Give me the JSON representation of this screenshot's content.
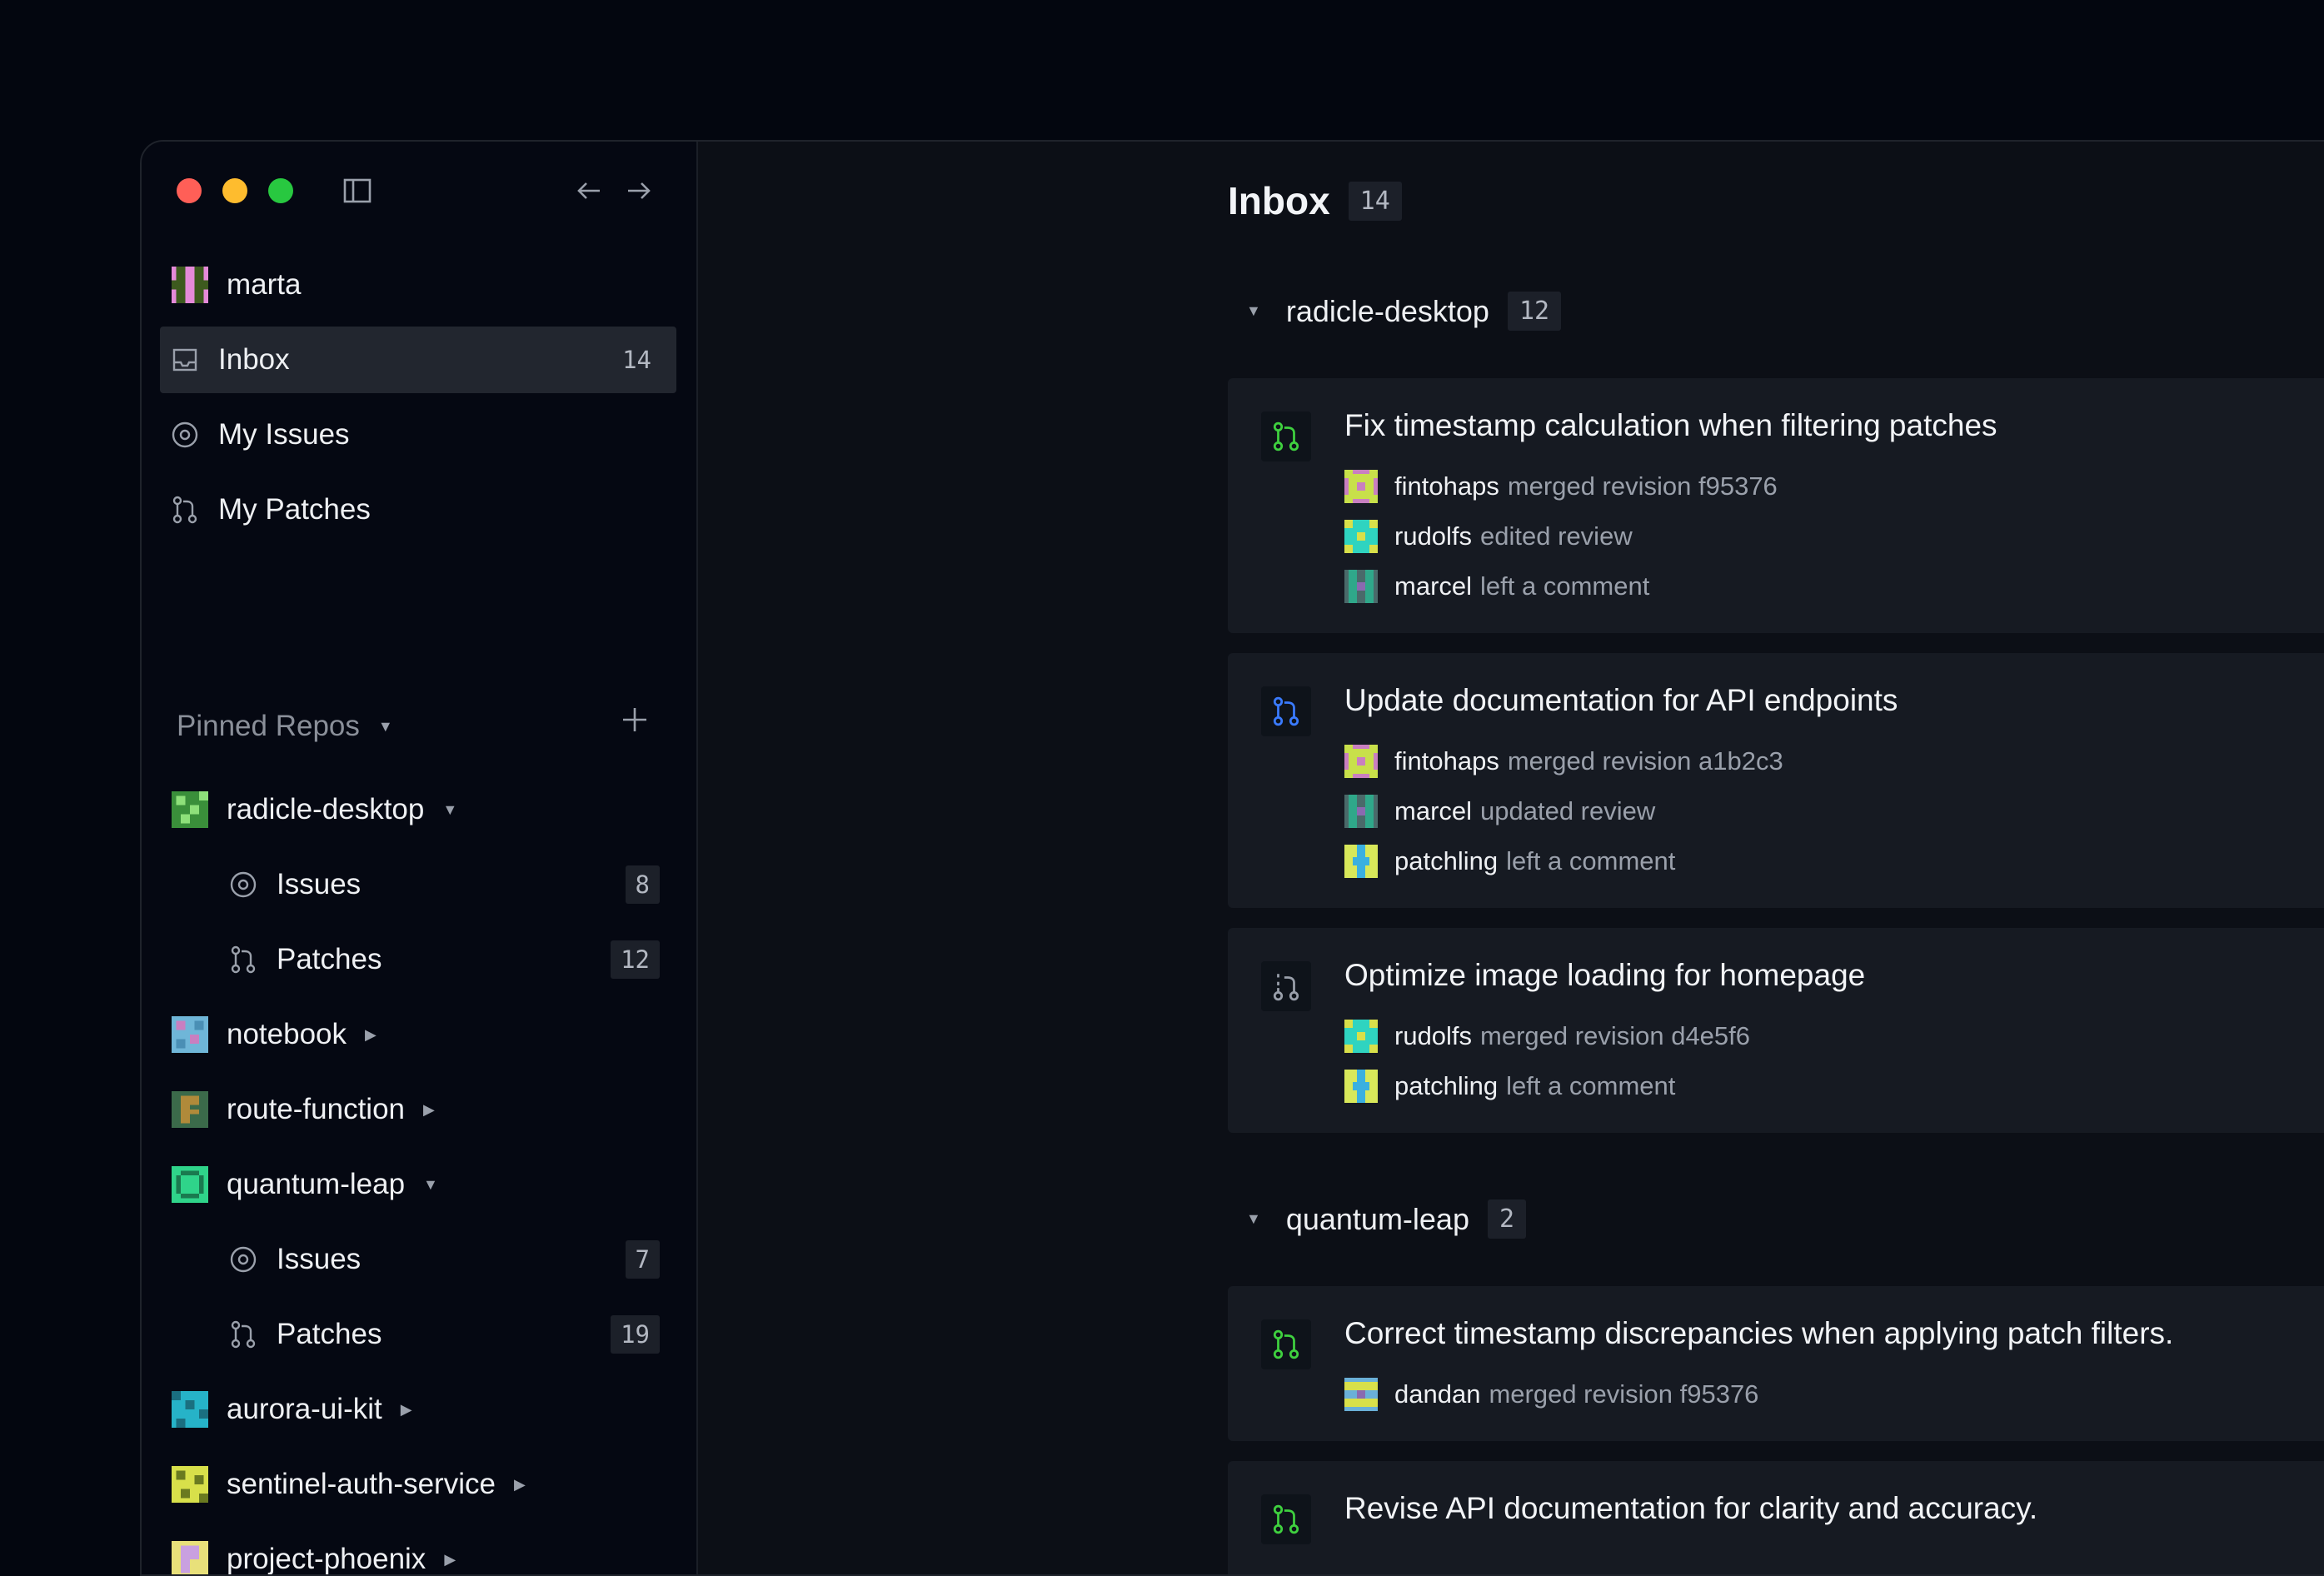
{
  "sidebar": {
    "user": {
      "name": "marta",
      "avatar": "marta-avatar"
    },
    "nav": [
      {
        "label": "Inbox",
        "count": "14",
        "icon": "inbox-icon",
        "active": true
      },
      {
        "label": "My Issues",
        "icon": "issue-icon"
      },
      {
        "label": "My Patches",
        "icon": "patch-icon"
      }
    ],
    "pinned_label": "Pinned Repos",
    "repos": [
      {
        "name": "radicle-desktop",
        "expanded": true,
        "children": [
          {
            "label": "Issues",
            "count": "8"
          },
          {
            "label": "Patches",
            "count": "12"
          }
        ]
      },
      {
        "name": "notebook"
      },
      {
        "name": "route-function"
      },
      {
        "name": "quantum-leap",
        "expanded": true,
        "children": [
          {
            "label": "Issues",
            "count": "7"
          },
          {
            "label": "Patches",
            "count": "19"
          }
        ]
      },
      {
        "name": "aurora-ui-kit"
      },
      {
        "name": "sentinel-auth-service"
      },
      {
        "name": "project-phoenix"
      }
    ]
  },
  "main": {
    "title": "Inbox",
    "count": "14",
    "groups": [
      {
        "repo": "radicle-desktop",
        "count": "12",
        "items": [
          {
            "title": "Fix timestamp calculation when filtering patches",
            "icon": "patch-merged-icon",
            "activity": [
              {
                "user": "fintohaps",
                "text": "merged revision f95376"
              },
              {
                "user": "rudolfs",
                "text": "edited review"
              },
              {
                "user": "marcel",
                "text": "left a comment"
              }
            ]
          },
          {
            "title": "Update documentation for API endpoints",
            "icon": "patch-open-icon",
            "activity": [
              {
                "user": "fintohaps",
                "text": "merged revision a1b2c3"
              },
              {
                "user": "marcel",
                "text": "updated review"
              },
              {
                "user": "patchling",
                "text": "left a comment"
              }
            ]
          },
          {
            "title": "Optimize image loading for homepage",
            "icon": "patch-draft-icon",
            "activity": [
              {
                "user": "rudolfs",
                "text": "merged revision d4e5f6"
              },
              {
                "user": "patchling",
                "text": "left a comment"
              }
            ]
          }
        ]
      },
      {
        "repo": "quantum-leap",
        "count": "2",
        "items": [
          {
            "title": "Correct timestamp discrepancies when applying patch filters.",
            "icon": "patch-merged-icon",
            "activity": [
              {
                "user": "dandan",
                "text": "merged revision f95376"
              }
            ]
          },
          {
            "title": "Revise API documentation for clarity and accuracy.",
            "icon": "patch-merged-icon",
            "activity": []
          }
        ]
      }
    ]
  },
  "colors": {
    "merged": "#3fd13f",
    "open": "#3a7bff",
    "draft": "#9aa0ab",
    "background": "#03060f"
  }
}
